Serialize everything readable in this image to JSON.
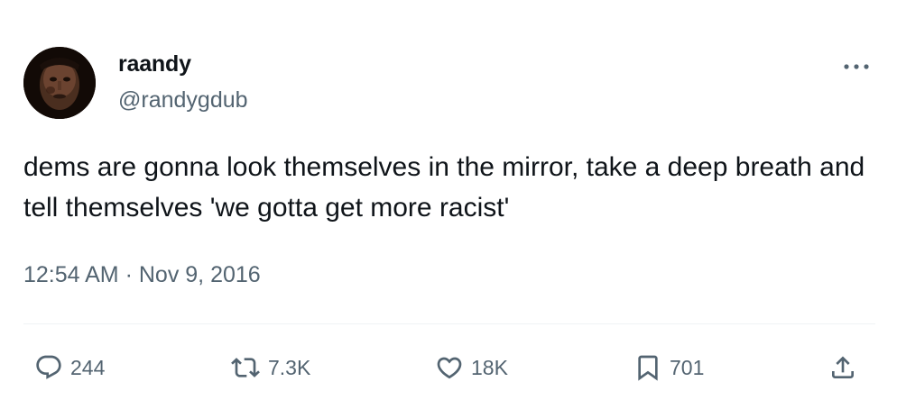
{
  "author": {
    "display_name": "raandy",
    "handle": "@randygdub"
  },
  "tweet": {
    "text": "dems are gonna look themselves in the mirror, take a deep breath and tell themselves 'we gotta get more racist'",
    "time": "12:54 AM",
    "separator": "·",
    "date": "Nov 9, 2016"
  },
  "actions": {
    "replies": "244",
    "retweets": "7.3K",
    "likes": "18K",
    "bookmarks": "701"
  },
  "icons": {
    "more": "more-icon",
    "reply": "reply-icon",
    "retweet": "retweet-icon",
    "like": "heart-icon",
    "bookmark": "bookmark-icon",
    "share": "share-icon"
  },
  "colors": {
    "text_primary": "#0f1419",
    "text_secondary": "#536471",
    "divider": "#eff3f4"
  }
}
